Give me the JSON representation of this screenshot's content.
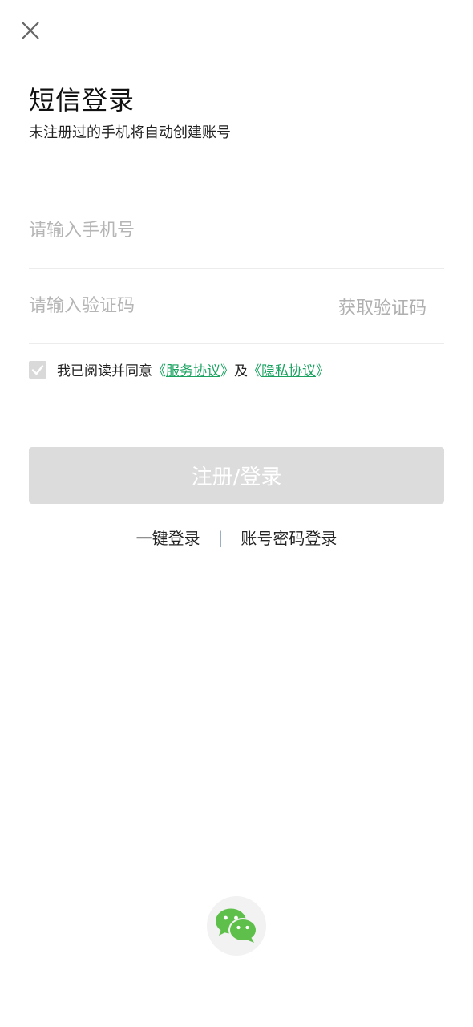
{
  "header": {
    "title": "短信登录",
    "subtitle": "未注册过的手机将自动创建账号"
  },
  "form": {
    "phone_placeholder": "请输入手机号",
    "phone_value": "",
    "code_placeholder": "请输入验证码",
    "code_value": "",
    "get_code_label": "获取验证码"
  },
  "agreement": {
    "prefix": "我已阅读并同意",
    "open_bracket": "《",
    "close_bracket": "》",
    "service_link": "服务协议",
    "conjunction": "及",
    "privacy_link": "隐私协议",
    "checked": true
  },
  "submit_label": "注册/登录",
  "alt_logins": {
    "one_click": "一键登录",
    "separator": "|",
    "password": "账号密码登录"
  },
  "icons": {
    "close": "close-icon",
    "check": "check-icon",
    "wechat": "wechat-icon"
  },
  "colors": {
    "link": "#1aa260",
    "wechat_green": "#5ec04b",
    "button_disabled": "#dcdcdc"
  }
}
